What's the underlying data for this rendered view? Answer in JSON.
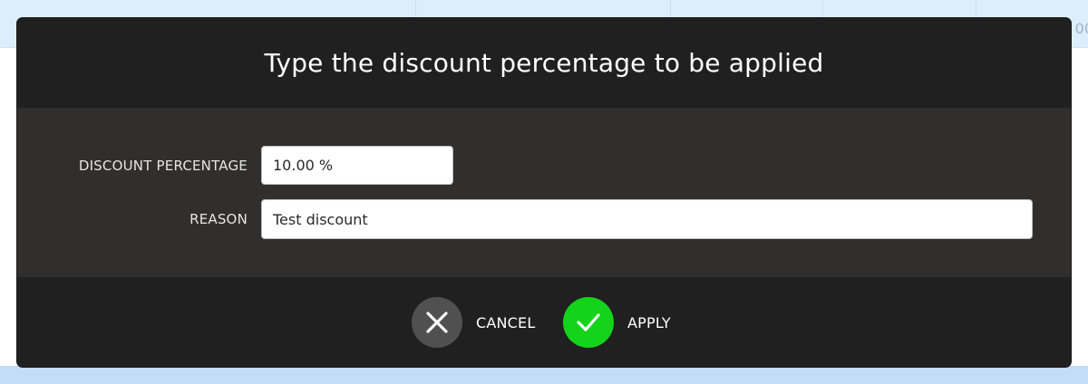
{
  "background": {
    "edge_text": "00"
  },
  "dialog": {
    "title": "Type the discount percentage to be applied",
    "fields": {
      "discount_percentage": {
        "label": "DISCOUNT PERCENTAGE",
        "value": "10.00 %"
      },
      "reason": {
        "label": "REASON",
        "value": "Test discount"
      }
    },
    "actions": {
      "cancel": {
        "label": "CANCEL",
        "icon": "close-icon"
      },
      "apply": {
        "label": "APPLY",
        "icon": "check-icon"
      }
    },
    "colors": {
      "apply_accent": "#14d31b",
      "cancel_accent": "#505050",
      "background_top": "#dceefc",
      "background_bottom": "#c3dcf7",
      "dialog_dark": "#202020",
      "dialog_body": "#302f2d"
    }
  }
}
